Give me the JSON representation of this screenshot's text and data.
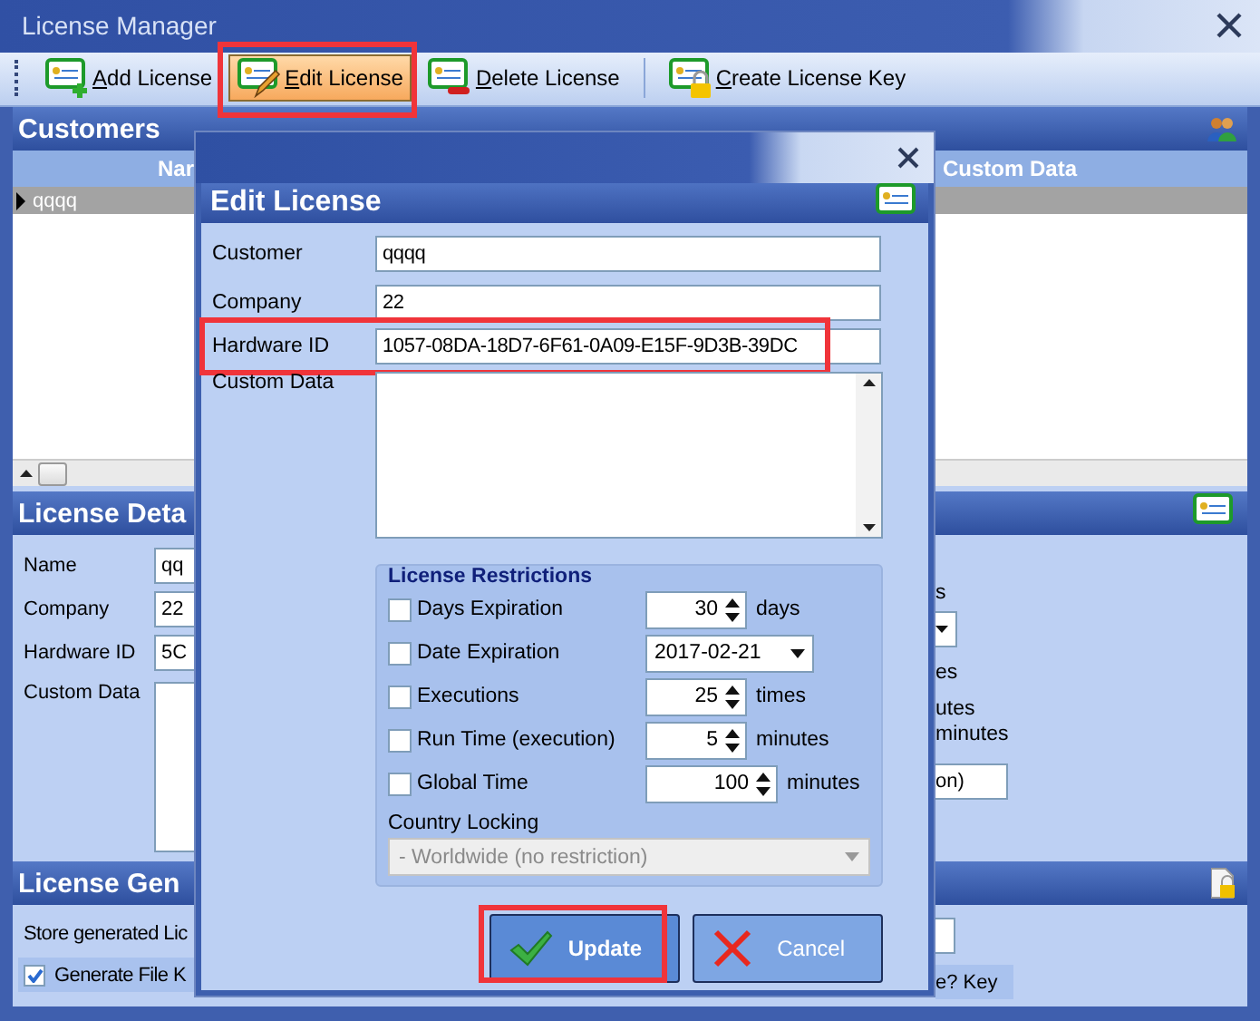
{
  "window": {
    "title": "License Manager"
  },
  "toolbar": [
    {
      "label": "Add License",
      "kind": "add",
      "highlighted": false
    },
    {
      "label": "Edit License",
      "kind": "edit",
      "highlighted": true
    },
    {
      "label": "Delete License",
      "kind": "delete",
      "highlighted": false
    },
    {
      "label": "Create License Key",
      "kind": "key",
      "highlighted": false
    }
  ],
  "customers": {
    "title": "Customers",
    "columns": [
      "Nar",
      "Custom Data"
    ],
    "rows": [
      {
        "cells": [
          "qqqq"
        ],
        "selected": true
      }
    ]
  },
  "details": {
    "title": "License Deta",
    "fields": [
      {
        "label": "Name",
        "value": "qq"
      },
      {
        "label": "Company",
        "value": "22"
      },
      {
        "label": "Hardware ID",
        "value": "5C"
      }
    ],
    "custom_data_label": "Custom Data",
    "right": [
      {
        "kind": "text",
        "text": "s"
      },
      {
        "kind": "select"
      },
      {
        "kind": "text",
        "text": "es"
      },
      {
        "kind": "text",
        "text": "utes"
      },
      {
        "kind": "text",
        "text": "minutes"
      },
      {
        "kind": "field",
        "text": "on)"
      }
    ]
  },
  "generation": {
    "title": "License Gen",
    "store_label": "Store generated Lic",
    "checkbox": {
      "label": "Generate File K",
      "checked": true
    },
    "right_checkbox_text": "e? Key"
  },
  "dialog": {
    "header": "Edit License",
    "fields": [
      {
        "label": "Customer",
        "value": "qqqq",
        "highlighted": false
      },
      {
        "label": "Company",
        "value": "22",
        "highlighted": false
      },
      {
        "label": "Hardware ID",
        "value": "1057-08DA-18D7-6F61-0A09-E15F-9D3B-39DC",
        "highlighted": true
      }
    ],
    "custom_data_label": "Custom Data",
    "restrictions": {
      "title": "License Restrictions",
      "rows": [
        {
          "label": "Days Expiration",
          "checked": false,
          "kind": "spin",
          "value": "30",
          "unit": "days",
          "wide": false
        },
        {
          "label": "Date Expiration",
          "checked": false,
          "kind": "date",
          "value": "2017-02-21"
        },
        {
          "label": "Executions",
          "checked": false,
          "kind": "spin",
          "value": "25",
          "unit": "times",
          "wide": false
        },
        {
          "label": "Run Time (execution)",
          "checked": false,
          "kind": "spin",
          "value": "5",
          "unit": "minutes",
          "wide": false
        },
        {
          "label": "Global Time",
          "checked": false,
          "kind": "spin",
          "value": "100",
          "unit": "minutes",
          "wide": true
        }
      ],
      "country_label": "Country Locking",
      "country_value": "- Worldwide (no restriction)",
      "country_disabled": true
    },
    "buttons": [
      {
        "label": "Update",
        "kind": "ok",
        "default": true,
        "highlighted": true
      },
      {
        "label": "Cancel",
        "kind": "cancel",
        "default": false,
        "highlighted": false
      }
    ]
  }
}
